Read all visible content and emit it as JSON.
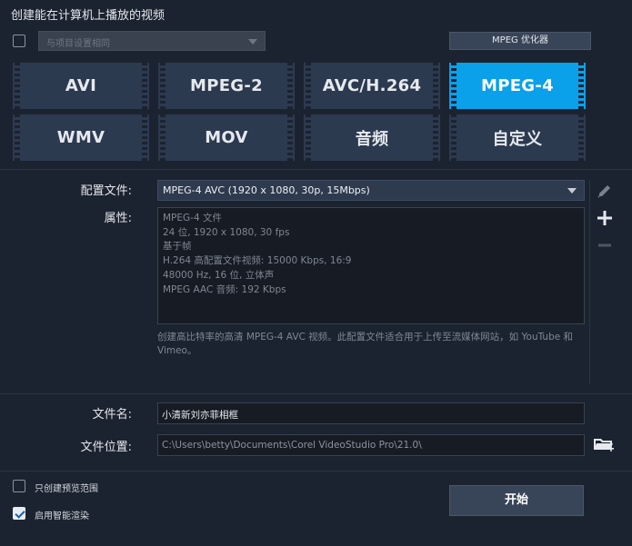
{
  "window": {
    "title": "创建能在计算机上播放的视频"
  },
  "top": {
    "project_settings_placeholder": "与项目设置相同",
    "mpeg_optimizer_label": "MPEG 优化器"
  },
  "formats": [
    {
      "label": "AVI",
      "selected": false
    },
    {
      "label": "MPEG-2",
      "selected": false
    },
    {
      "label": "AVC/H.264",
      "selected": false
    },
    {
      "label": "MPEG-4",
      "selected": true
    },
    {
      "label": "WMV",
      "selected": false
    },
    {
      "label": "MOV",
      "selected": false
    },
    {
      "label": "音频",
      "selected": false
    },
    {
      "label": "自定义",
      "selected": false
    }
  ],
  "profile": {
    "label": "配置文件:",
    "value": "MPEG-4 AVC (1920 x 1080, 30p, 15Mbps)"
  },
  "properties": {
    "label": "属性:",
    "lines": [
      "MPEG-4 文件",
      "24 位, 1920 x 1080, 30 fps",
      "基于帧",
      "H.264 高配置文件视频: 15000 Kbps, 16:9",
      "48000 Hz, 16 位, 立体声",
      "MPEG AAC 音频: 192 Kbps"
    ]
  },
  "description": "创建高比特率的高清 MPEG-4 AVC 视频。此配置文件适合用于上传至流媒体网站，如 YouTube 和 Vimeo。",
  "file": {
    "name_label": "文件名:",
    "name_value": "小清新刘亦菲相框",
    "location_label": "文件位置:",
    "location_value": "C:\\Users\\betty\\Documents\\Corel VideoStudio Pro\\21.0\\"
  },
  "options": {
    "preview_range_label": "只创建预览范围",
    "preview_range_checked": false,
    "smart_render_label": "启用智能渲染",
    "smart_render_checked": true
  },
  "start_label": "开始",
  "colors": {
    "background": "#1c2330",
    "format_tile": "#2c3a50",
    "format_selected": "#0aa0ea"
  }
}
